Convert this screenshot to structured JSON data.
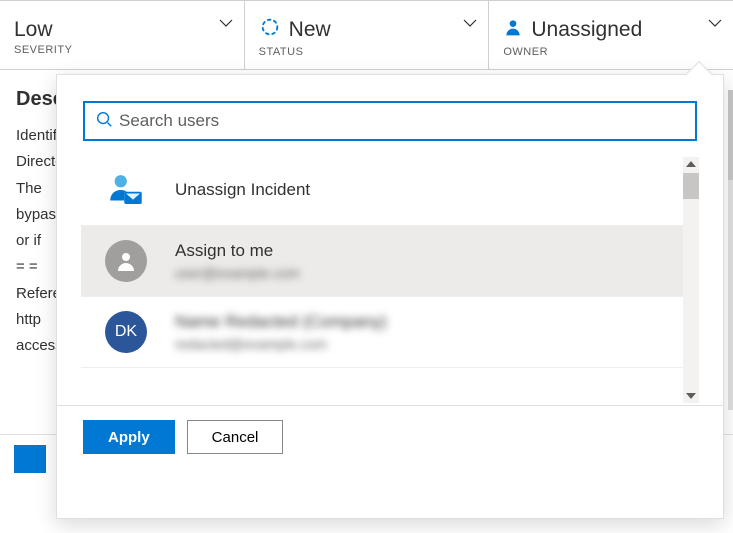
{
  "header": {
    "severity": {
      "value": "Low",
      "label": "SEVERITY"
    },
    "status": {
      "value": "New",
      "label": "STATUS"
    },
    "owner": {
      "value": "Unassigned",
      "label": "OWNER"
    }
  },
  "description": {
    "heading": "Description",
    "lines": [
      "Identifies",
      "Directory",
      "The",
      "bypass",
      "or if",
      "= =",
      "Reference",
      "http",
      "access"
    ]
  },
  "flyout": {
    "search_placeholder": "Search users",
    "items": [
      {
        "type": "unassign",
        "title": "Unassign Incident"
      },
      {
        "type": "me",
        "title": "Assign to me",
        "sub_redacted": "user@example.com"
      },
      {
        "type": "user",
        "initials": "DK",
        "title_redacted": "Name Redacted (Company)",
        "sub_redacted": "redacted@example.com"
      }
    ],
    "apply_label": "Apply",
    "cancel_label": "Cancel"
  }
}
